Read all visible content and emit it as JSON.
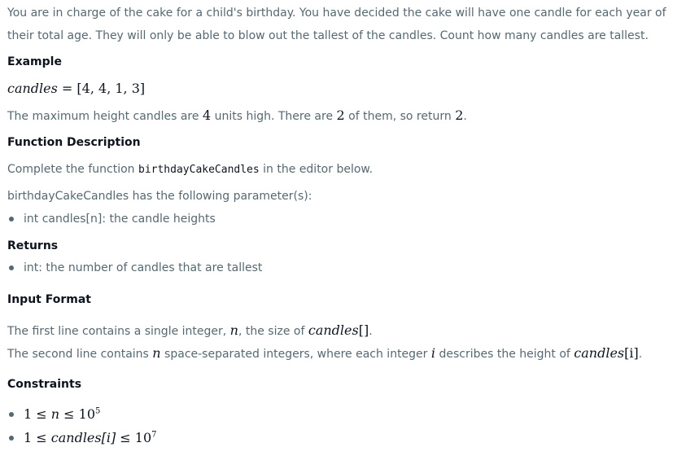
{
  "problem": {
    "intro": "You are in charge of the cake for a child's birthday. You have decided the cake will have one candle for each year of their total age. They will only be able to blow out the tallest of the candles. Count how many candles are tallest.",
    "example_heading": "Example",
    "example_var": "candles",
    "example_eq": " = ",
    "example_value": "[4, 4, 1, 3]",
    "example_text_1": "The maximum height candles are ",
    "example_num_1": "4",
    "example_text_2": " units high. There are ",
    "example_num_2": "2",
    "example_text_3": " of them, so return ",
    "example_num_3": "2",
    "example_text_4": ".",
    "function_heading": "Function Description",
    "function_text_1": "Complete the function ",
    "function_name": "birthdayCakeCandles",
    "function_text_2": " in the editor below.",
    "params_intro": "birthdayCakeCandles has the following parameter(s):",
    "params": [
      "int candles[n]: the candle heights"
    ],
    "returns_heading": "Returns",
    "returns": [
      "int: the number of candles that are tallest"
    ],
    "input_heading": "Input Format",
    "input_line1_a": "The first line contains a single integer, ",
    "input_line1_var": "n",
    "input_line1_b": ", the size of ",
    "input_line1_arr": "candles",
    "input_line1_brackets": "[]",
    "input_line1_c": ".",
    "input_line2_a": "The second line contains ",
    "input_line2_var": "n",
    "input_line2_b": " space-separated integers, where each integer ",
    "input_line2_i": "i",
    "input_line2_c": " describes the height of ",
    "input_line2_arr": "candles",
    "input_line2_idx": "[i]",
    "input_line2_d": ".",
    "constraints_heading": "Constraints",
    "constraint_1": {
      "lhs": "1 ≤ ",
      "var": "n",
      "op": " ≤ 10",
      "exp": "5"
    },
    "constraint_2": {
      "lhs": "1 ≤ ",
      "var": "candles",
      "idx": "[i]",
      "op": " ≤ 10",
      "exp": "7"
    }
  },
  "colors": {
    "body_text": "#576871",
    "heading_text": "#0e141e"
  }
}
